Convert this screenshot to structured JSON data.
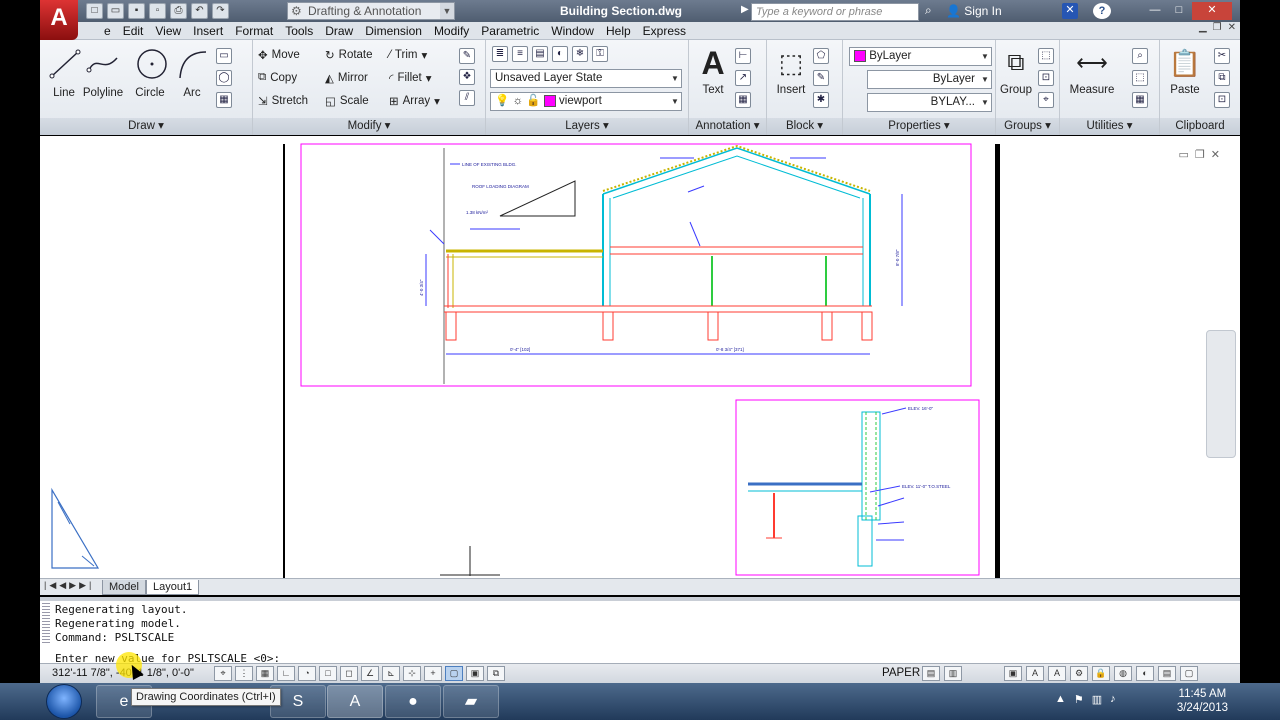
{
  "titlebar": {
    "workspace": "Drafting & Annotation",
    "document_title": "Building Section.dwg",
    "search_placeholder": "Type a keyword or phrase",
    "sign_in": "Sign In"
  },
  "menubar": {
    "items": [
      "e",
      "Edit",
      "View",
      "Insert",
      "Format",
      "Tools",
      "Draw",
      "Dimension",
      "Modify",
      "Parametric",
      "Window",
      "Help",
      "Express"
    ]
  },
  "ribbon": {
    "draw": {
      "label": "Draw",
      "tools": [
        "Line",
        "Polyline",
        "Circle",
        "Arc"
      ]
    },
    "modify": {
      "label": "Modify",
      "tools": [
        "Move",
        "Rotate",
        "Trim",
        "Copy",
        "Mirror",
        "Fillet",
        "Stretch",
        "Scale",
        "Array"
      ]
    },
    "layers": {
      "label": "Layers",
      "layer_state": "Unsaved Layer State",
      "current_layer": "viewport"
    },
    "annotation": {
      "label": "Annotation",
      "text": "Text"
    },
    "block": {
      "label": "Block",
      "insert": "Insert"
    },
    "properties": {
      "label": "Properties",
      "color": "ByLayer",
      "linetype": "ByLayer",
      "lineweight": "BYLAY..."
    },
    "groups": {
      "label": "Groups",
      "group": "Group"
    },
    "utilities": {
      "label": "Utilities",
      "measure": "Measure"
    },
    "clipboard": {
      "label": "Clipboard",
      "paste": "Paste"
    }
  },
  "drawing_text": {
    "leader_1": "LINE OF EXISTING BLDG.",
    "leader_2": "ROOF LOADING DIAGRAM",
    "load_value": "1.38 kN/m²",
    "dim_left": "0'-4\" [102]",
    "dim_right": "0'-8 3/4\" [371]",
    "dim_height_left": "4'-0 3/4\"",
    "dim_height_right": "8'-0 7/8\"",
    "elev_top": "ELEV. 16'-0\"",
    "elev_mid": "ELEV. 11'-0\" T.O.STEEL"
  },
  "tabs": {
    "model": "Model",
    "layout": "Layout1"
  },
  "command_line": {
    "history": [
      "Regenerating layout.",
      "Regenerating model.",
      "Command: PSLTSCALE"
    ],
    "prompt": "Enter new value for PSLTSCALE <0>:"
  },
  "status_bar": {
    "coordinates": "312'-11 7/8\", -40'-1 1/8\", 0'-0\"",
    "space": "PAPER"
  },
  "tooltip": {
    "text": "Drawing Coordinates (Ctrl+I)"
  },
  "taskbar": {
    "time": "11:45 AM",
    "date": "3/24/2013"
  },
  "colors": {
    "accent_magenta": "#ff00ff",
    "cyan": "#00bcd4",
    "green": "#2ecc40",
    "red": "#ff3b30"
  }
}
